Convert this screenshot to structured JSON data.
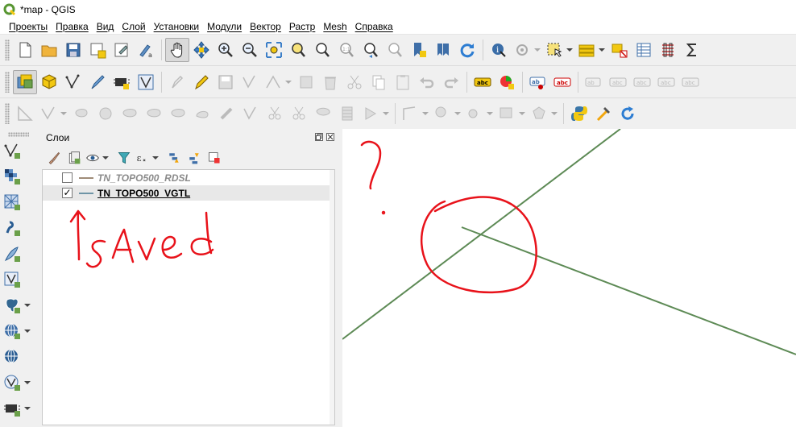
{
  "window": {
    "title": "*map - QGIS"
  },
  "menu": [
    "Проекты",
    "Правка",
    "Вид",
    "Слой",
    "Установки",
    "Модули",
    "Вектор",
    "Растр",
    "Mesh",
    "Справка"
  ],
  "layers_panel": {
    "title": "Слои",
    "layers": [
      {
        "name": "TN_TOPO500_RDSL",
        "checked": false,
        "color": "#a08c78"
      },
      {
        "name": "TN_TOPO500_VGTL",
        "checked": true,
        "color": "#6e94a6"
      }
    ]
  },
  "canvas": {
    "line_color": "#5d8a55"
  },
  "annotations": {
    "handwriting": "?",
    "handwriting_saved": "saved",
    "color": "#e8121a"
  },
  "icons": {
    "toolbar1": [
      "new-project-icon",
      "open-project-icon",
      "save-project-icon",
      "save-as-icon",
      "print-layout-icon",
      "style-manager-icon",
      "pan-map-icon",
      "pan-to-selection-icon",
      "zoom-in-icon",
      "zoom-out-icon",
      "zoom-full-icon",
      "zoom-to-selection-icon",
      "zoom-to-layer-icon",
      "zoom-native-icon",
      "zoom-last-icon",
      "zoom-next-icon",
      "new-bookmark-icon",
      "show-bookmarks-icon",
      "refresh-icon",
      "identify-icon",
      "run-action-icon",
      "select-features-icon",
      "open-attribute-table-icon",
      "statistics-icon",
      "field-calculator-icon"
    ],
    "toolbar2": [
      "data-source-manager-icon",
      "new-geopackage-icon",
      "new-shapefile-icon",
      "digitize-icon",
      "gps-icon",
      "vertex-tool-icon",
      "current-edits-icon",
      "toggle-editing-icon",
      "save-edits-icon",
      "add-feature-icon",
      "vertex-tool-dim-icon",
      "modify-attributes-icon",
      "delete-selected-icon",
      "cut-features-icon",
      "copy-features-icon",
      "paste-features-icon",
      "undo-icon",
      "redo-icon",
      "label-toolbar-icon",
      "diagram-icon",
      "layer-labeling-icon",
      "highlight-pinned-icon",
      "pin-labels-icon",
      "show-hide-labels-icon",
      "move-label-icon",
      "rotate-label-icon",
      "change-label-icon"
    ],
    "toolbar3": [
      "advanced-digitizing-icon",
      "add-circular-string-icon",
      "add-ring-icon",
      "add-part-icon",
      "fill-ring-icon",
      "delete-ring-icon",
      "delete-part-icon",
      "reshape-icon",
      "offset-curve-icon",
      "simplify-icon",
      "split-features-icon",
      "split-parts-icon",
      "merge-features-icon",
      "merge-attributes-icon",
      "rotate-point-symbols-icon",
      "offset-point-symbols-icon",
      "trace-icon",
      "reverse-line-icon",
      "python-console-icon",
      "processing-toolbox-icon",
      "refresh-plugin-icon"
    ]
  }
}
